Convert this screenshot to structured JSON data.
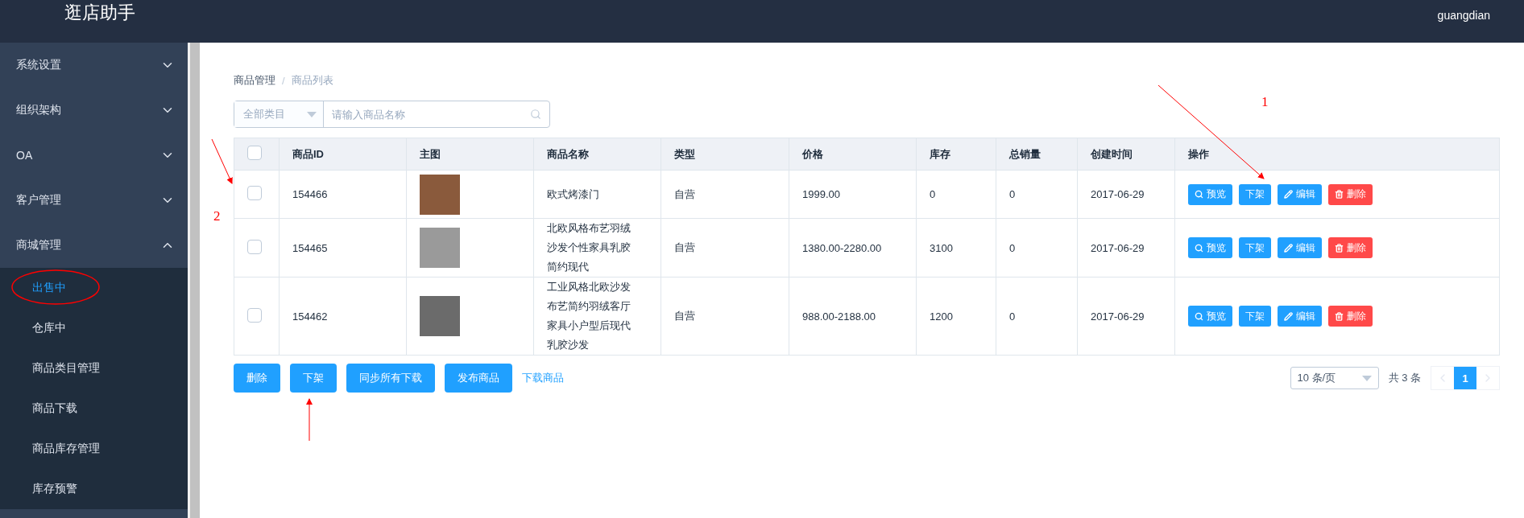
{
  "header": {
    "title": "逛店助手",
    "user": "guangdian"
  },
  "sidebar": {
    "groups": [
      {
        "label": "系统设置",
        "expanded": false
      },
      {
        "label": "组织架构",
        "expanded": false
      },
      {
        "label": "OA",
        "expanded": false
      },
      {
        "label": "客户管理",
        "expanded": false
      },
      {
        "label": "商城管理",
        "expanded": true,
        "children": [
          {
            "label": "出售中",
            "selected": true
          },
          {
            "label": "仓库中",
            "selected": false
          },
          {
            "label": "商品类目管理",
            "selected": false
          },
          {
            "label": "商品下载",
            "selected": false
          },
          {
            "label": "商品库存管理",
            "selected": false
          },
          {
            "label": "库存预警",
            "selected": false
          }
        ]
      }
    ]
  },
  "breadcrumb": {
    "items": [
      "商品管理",
      "商品列表"
    ],
    "separator": "/"
  },
  "search": {
    "category": "全部类目",
    "placeholder": "请输入商品名称"
  },
  "table": {
    "all_checked": false,
    "columns": [
      "商品ID",
      "主图",
      "商品名称",
      "类型",
      "价格",
      "库存",
      "总销量",
      "创建时间",
      "操作"
    ],
    "rows": [
      {
        "checked": false,
        "id": "154466",
        "name": "欧式烤漆门",
        "type": "自营",
        "price": "1999.00",
        "stock": "0",
        "sales": "0",
        "created": "2017-06-29",
        "actions": [
          {
            "kind": "preview",
            "label": "预览"
          },
          {
            "kind": "unlist",
            "label": "下架"
          },
          {
            "kind": "edit",
            "label": "编辑"
          },
          {
            "kind": "delete",
            "label": "删除"
          }
        ]
      },
      {
        "checked": false,
        "id": "154465",
        "name": "北欧风格布艺羽绒沙发个性家具乳胶简约现代",
        "type": "自营",
        "price": "1380.00-2280.00",
        "stock": "3100",
        "sales": "0",
        "created": "2017-06-29",
        "actions": [
          {
            "kind": "preview",
            "label": "预览"
          },
          {
            "kind": "unlist",
            "label": "下架"
          },
          {
            "kind": "edit",
            "label": "编辑"
          },
          {
            "kind": "delete",
            "label": "删除"
          }
        ]
      },
      {
        "checked": false,
        "id": "154462",
        "name": "工业风格北欧沙发布艺简约羽绒客厅家具小户型后现代乳胶沙发",
        "type": "自营",
        "price": "988.00-2188.00",
        "stock": "1200",
        "sales": "0",
        "created": "2017-06-29",
        "actions": [
          {
            "kind": "preview",
            "label": "预览"
          },
          {
            "kind": "unlist",
            "label": "下架"
          },
          {
            "kind": "edit",
            "label": "编辑"
          },
          {
            "kind": "delete",
            "label": "删除"
          }
        ]
      }
    ]
  },
  "bottom_actions": {
    "buttons": [
      "删除",
      "下架",
      "同步所有下载",
      "发布商品"
    ],
    "link": "下载商品"
  },
  "pagination": {
    "page_size": "10 条/页",
    "total": "共 3 条",
    "pages": [
      {
        "label": "1",
        "selected": true
      }
    ]
  },
  "annotations": [
    {
      "label": "1"
    },
    {
      "label": "2"
    }
  ]
}
